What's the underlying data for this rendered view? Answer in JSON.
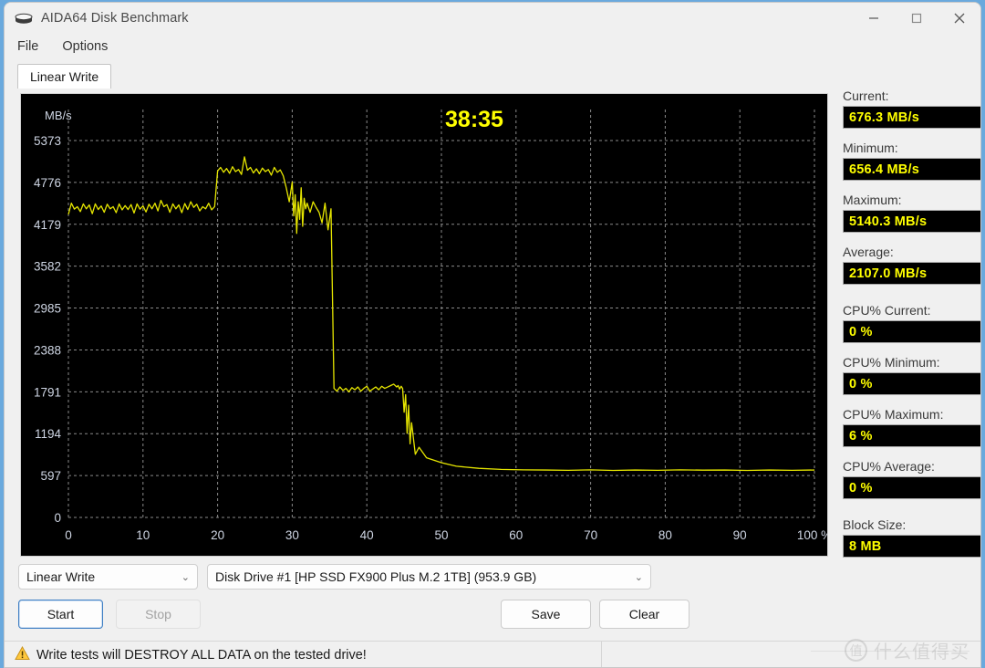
{
  "window": {
    "title": "AIDA64 Disk Benchmark",
    "icon": "disk-drive-icon",
    "minimize": "—",
    "maximize": "☐",
    "close": "✕"
  },
  "menu": {
    "items": [
      "File",
      "Options"
    ]
  },
  "tabs": [
    {
      "label": "Linear Write",
      "active": true
    }
  ],
  "chart": {
    "timer": "38:35",
    "unit_label": "MB/s",
    "x_unit": "%",
    "line_color": "#e6e600",
    "grid_color": "#8a8a8a",
    "background": "#000000",
    "axis_text_color": "#cfd6e4",
    "timer_color": "#ffff00"
  },
  "chart_data": {
    "type": "line",
    "title": "Linear Write",
    "xlabel": "%",
    "ylabel": "MB/s",
    "xlim": [
      0,
      100
    ],
    "ylim": [
      0,
      5373
    ],
    "grid": true,
    "legend": false,
    "yticks": [
      0,
      597,
      1194,
      1791,
      2388,
      2985,
      3582,
      4179,
      4776,
      5373
    ],
    "xticks": [
      0,
      10,
      20,
      30,
      40,
      50,
      60,
      70,
      80,
      90,
      100
    ],
    "xtick_labels": [
      "0",
      "10",
      "20",
      "30",
      "40",
      "50",
      "60",
      "70",
      "80",
      "90",
      "100 %"
    ],
    "annotations": [
      {
        "text": "38:35",
        "x": 50,
        "y": 5200
      }
    ],
    "series": [
      {
        "name": "Linear Write speed",
        "color": "#e6e600",
        "x": [
          0,
          0.4,
          0.8,
          1.2,
          1.6,
          2,
          2.4,
          2.8,
          3.2,
          3.6,
          4,
          4.4,
          4.8,
          5.2,
          5.6,
          6,
          6.4,
          6.8,
          7.2,
          7.6,
          8,
          8.4,
          8.8,
          9.2,
          9.6,
          10,
          10.4,
          10.8,
          11.2,
          11.6,
          12,
          12.4,
          12.8,
          13.2,
          13.6,
          14,
          14.4,
          14.8,
          15.2,
          15.6,
          16,
          16.4,
          16.8,
          17.2,
          17.6,
          18,
          18.4,
          18.8,
          19.2,
          19.6,
          20,
          20.4,
          20.8,
          21.2,
          21.6,
          22,
          22.4,
          22.8,
          23.2,
          23.6,
          24,
          24.4,
          24.8,
          25.2,
          25.6,
          26,
          26.4,
          26.8,
          27.2,
          27.6,
          28,
          28.4,
          28.8,
          29.2,
          29.6,
          30,
          30.2,
          30.4,
          30.6,
          30.8,
          31,
          31.2,
          31.4,
          31.6,
          31.8,
          32,
          32.4,
          32.8,
          33.2,
          33.6,
          34,
          34.4,
          34.8,
          35.2,
          35.6,
          36,
          36.4,
          36.8,
          37.2,
          37.6,
          38,
          38.4,
          38.8,
          39.2,
          39.6,
          40,
          40.4,
          40.8,
          41.2,
          41.6,
          42,
          42.4,
          42.8,
          43.2,
          43.6,
          44,
          44.2,
          44.4,
          44.6,
          44.8,
          45,
          45.2,
          45.4,
          45.6,
          45.8,
          46,
          46.5,
          47,
          48,
          50,
          52,
          55,
          58,
          61,
          64,
          67,
          70,
          73,
          76,
          79,
          82,
          85,
          88,
          91,
          94,
          97,
          100
        ],
        "y": [
          4320,
          4480,
          4395,
          4430,
          4360,
          4470,
          4400,
          4455,
          4330,
          4470,
          4390,
          4440,
          4350,
          4465,
          4400,
          4430,
          4345,
          4470,
          4385,
          4445,
          4390,
          4460,
          4340,
          4470,
          4395,
          4440,
          4355,
          4465,
          4400,
          4480,
          4370,
          4520,
          4430,
          4460,
          4350,
          4470,
          4400,
          4455,
          4345,
          4475,
          4390,
          4500,
          4420,
          4465,
          4370,
          4430,
          4400,
          4480,
          4385,
          4430,
          4940,
          4990,
          4920,
          4975,
          4905,
          5000,
          4930,
          4960,
          4890,
          5140,
          4950,
          4990,
          4910,
          4970,
          4900,
          4980,
          4930,
          4960,
          4880,
          4990,
          4920,
          4955,
          4870,
          4700,
          4500,
          4780,
          4300,
          4600,
          4050,
          4500,
          4250,
          4700,
          4150,
          4550,
          4400,
          4480,
          4350,
          4500,
          4420,
          4350,
          4200,
          4480,
          4100,
          4400,
          1840,
          1800,
          1860,
          1810,
          1840,
          1790,
          1850,
          1820,
          1860,
          1800,
          1840,
          1870,
          1800,
          1830,
          1860,
          1820,
          1870,
          1840,
          1860,
          1880,
          1900,
          1860,
          1880,
          1830,
          1870,
          1840,
          1500,
          1750,
          1200,
          1600,
          1050,
          1350,
          900,
          1000,
          850,
          780,
          730,
          700,
          685,
          678,
          676,
          672,
          678,
          670,
          676,
          672,
          678,
          674,
          676,
          670,
          676,
          672,
          676,
          674,
          676
        ]
      }
    ]
  },
  "stats": [
    {
      "label": "Current:",
      "value": "676.3 MB/s",
      "gap_after": false
    },
    {
      "label": "Minimum:",
      "value": "656.4 MB/s",
      "gap_after": false
    },
    {
      "label": "Maximum:",
      "value": "5140.3 MB/s",
      "gap_after": false
    },
    {
      "label": "Average:",
      "value": "2107.0 MB/s",
      "gap_after": true
    },
    {
      "label": "CPU% Current:",
      "value": "0 %",
      "gap_after": false
    },
    {
      "label": "CPU% Minimum:",
      "value": "0 %",
      "gap_after": false
    },
    {
      "label": "CPU% Maximum:",
      "value": "6 %",
      "gap_after": false
    },
    {
      "label": "CPU% Average:",
      "value": "0 %",
      "gap_after": true
    },
    {
      "label": "Block Size:",
      "value": "8 MB",
      "gap_after": false
    }
  ],
  "controls": {
    "mode_select": {
      "value": "Linear Write"
    },
    "drive_select": {
      "value": "Disk Drive #1  [HP SSD FX900 Plus M.2 1TB]  (953.9 GB)"
    },
    "caret": "⌄",
    "start_label": "Start",
    "stop_label": "Stop",
    "save_label": "Save",
    "clear_label": "Clear"
  },
  "warning": {
    "icon": "warning-triangle-icon",
    "text": "Write tests will DESTROY ALL DATA on the tested drive!"
  },
  "watermark": {
    "badge": "值",
    "text": "什么值得买"
  }
}
